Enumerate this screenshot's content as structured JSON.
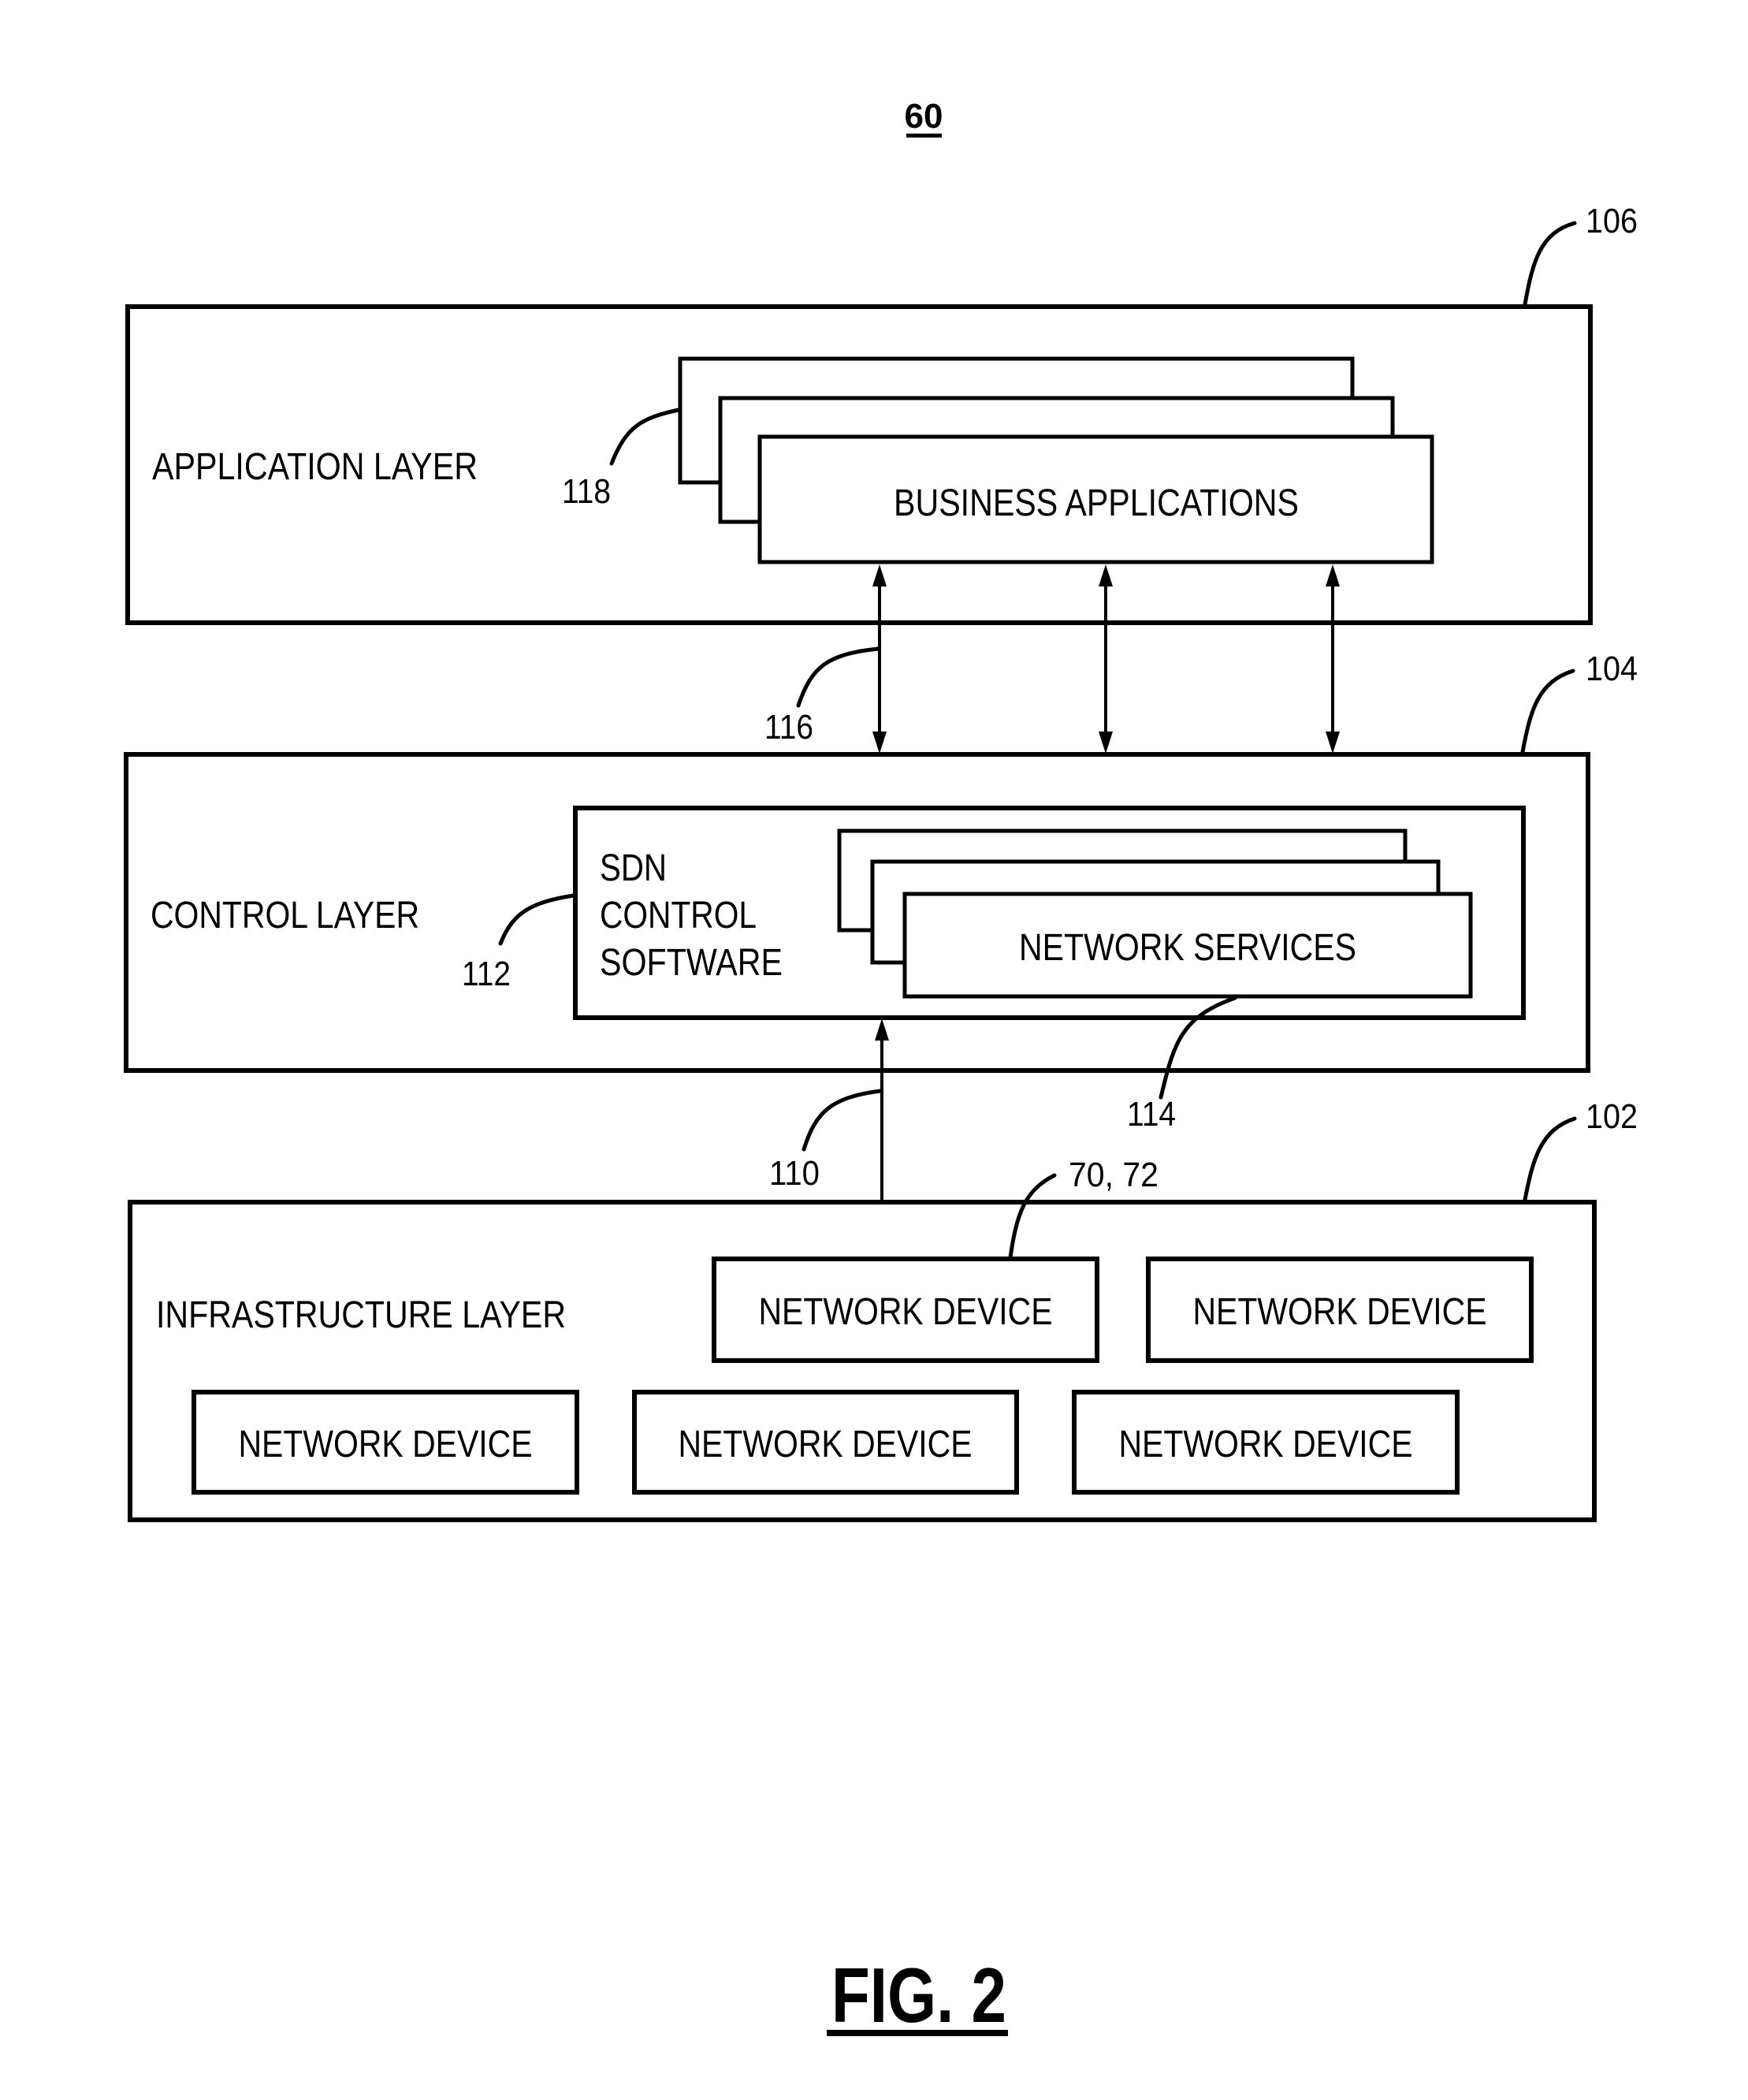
{
  "figure": {
    "number_label": "60",
    "caption": "FIG. 2"
  },
  "layers": {
    "application": {
      "title": "APPLICATION LAYER",
      "ref": "106",
      "apps_ref": "118",
      "apps_label": "BUSINESS APPLICATIONS"
    },
    "control": {
      "title": "CONTROL LAYER",
      "ref": "104",
      "sdn_ref": "112",
      "sdn_label_lines": [
        "SDN",
        "CONTROL",
        "SOFTWARE"
      ],
      "services_ref": "114",
      "services_label": "NETWORK SERVICES"
    },
    "infrastructure": {
      "title": "INFRASTRUCTURE LAYER",
      "ref": "102",
      "device_ref": "70, 72",
      "devices": [
        "NETWORK DEVICE",
        "NETWORK DEVICE",
        "NETWORK DEVICE",
        "NETWORK DEVICE",
        "NETWORK DEVICE"
      ]
    }
  },
  "interfaces": {
    "northbound_ref": "116",
    "southbound_ref": "110"
  }
}
